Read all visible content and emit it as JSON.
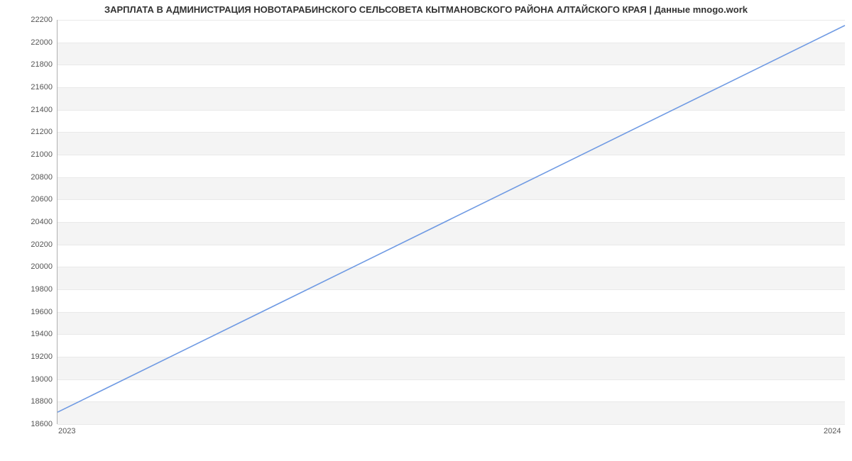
{
  "chart_data": {
    "type": "line",
    "title": "ЗАРПЛАТА В АДМИНИСТРАЦИЯ НОВОТАРАБИНСКОГО СЕЛЬСОВЕТА КЫТМАНОВСКОГО РАЙОНА АЛТАЙСКОГО КРАЯ | Данные mnogo.work",
    "x": [
      2023,
      2024
    ],
    "values": [
      18700,
      22150
    ],
    "xlabel": "",
    "ylabel": "",
    "xlim": [
      2023,
      2024
    ],
    "ylim": [
      18600,
      22200
    ],
    "x_ticks": [
      2023,
      2024
    ],
    "y_ticks": [
      18600,
      18800,
      19000,
      19200,
      19400,
      19600,
      19800,
      20000,
      20200,
      20400,
      20600,
      20800,
      21000,
      21200,
      21400,
      21600,
      21800,
      22000,
      22200
    ],
    "line_color": "#6f9ae3",
    "band_color": "#f4f4f4"
  }
}
